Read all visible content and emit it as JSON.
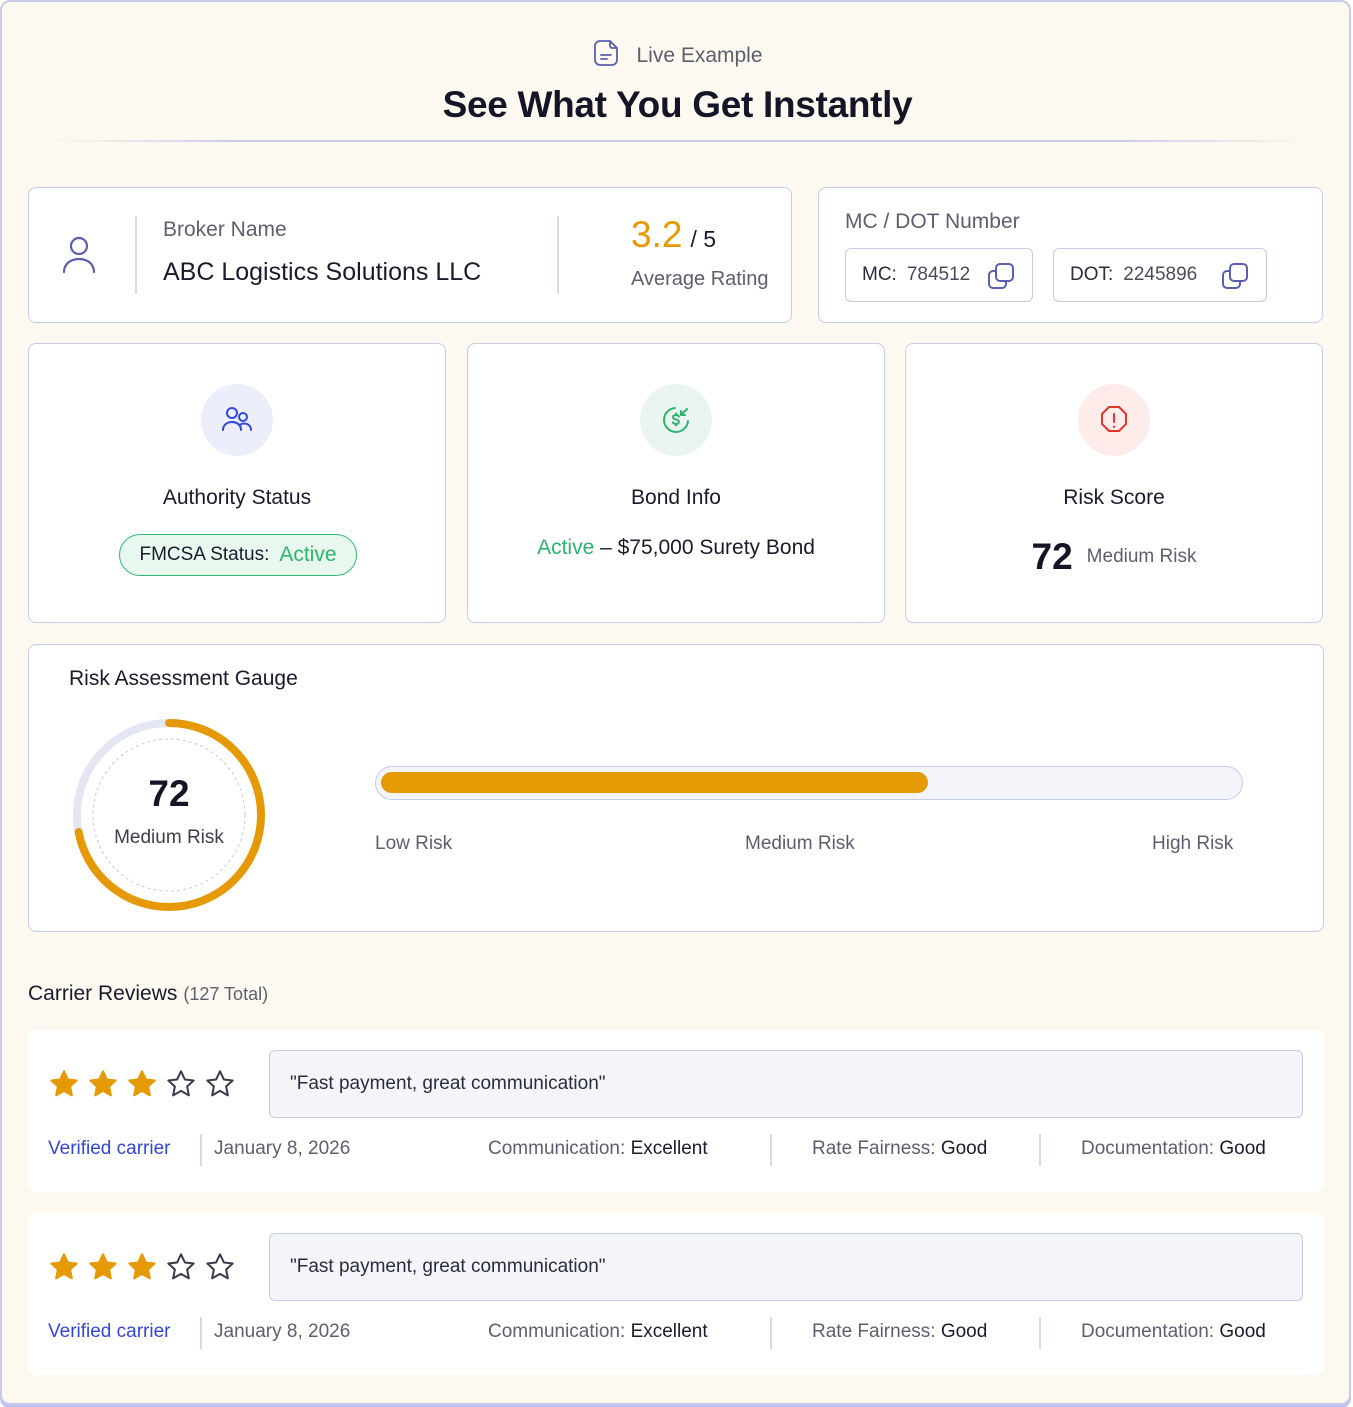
{
  "header": {
    "eyebrow": "Live Example",
    "title": "See What You Get Instantly"
  },
  "broker": {
    "label": "Broker Name",
    "name": "ABC Logistics Solutions LLC",
    "rating": "3.2",
    "rating_max": "/ 5",
    "rating_label": "Average Rating"
  },
  "numbers": {
    "label": "MC / DOT Number",
    "mc_label": "MC:",
    "mc_value": "784512",
    "dot_label": "DOT:",
    "dot_value": "2245896"
  },
  "authority": {
    "title": "Authority Status",
    "status_label": "FMCSA Status:",
    "status_value": "Active"
  },
  "bond": {
    "title": "Bond Info",
    "status": "Active",
    "detail": "– $75,000 Surety Bond"
  },
  "risk": {
    "title": "Risk Score",
    "score": "72",
    "level": "Medium Risk"
  },
  "gauge": {
    "title": "Risk Assessment Gauge",
    "score": "72",
    "level": "Medium Risk",
    "fraction": 0.72,
    "bar_fraction": 0.64,
    "labels": {
      "low": "Low Risk",
      "medium": "Medium Risk",
      "high": "High Risk"
    }
  },
  "reviews": {
    "title": "Carrier Reviews",
    "total": "(127 Total)",
    "items": [
      {
        "stars": 3,
        "quote": "\"Fast payment, great communication\"",
        "verified": "Verified carrier",
        "date": "January 8, 2026",
        "comm_label": "Communication:",
        "comm_value": "Excellent",
        "rate_label": "Rate Fairness:",
        "rate_value": "Good",
        "doc_label": "Documentation:",
        "doc_value": "Good"
      },
      {
        "stars": 3,
        "quote": "\"Fast payment, great communication\"",
        "verified": "Verified carrier",
        "date": "January 8, 2026",
        "comm_label": "Communication:",
        "comm_value": "Excellent",
        "rate_label": "Rate Fairness:",
        "rate_value": "Good",
        "doc_label": "Documentation:",
        "doc_value": "Good"
      }
    ]
  },
  "colors": {
    "accent_orange": "#e59a05",
    "active_green": "#2fb36e",
    "link_blue": "#3347d6",
    "risk_red": "#e0362c"
  }
}
